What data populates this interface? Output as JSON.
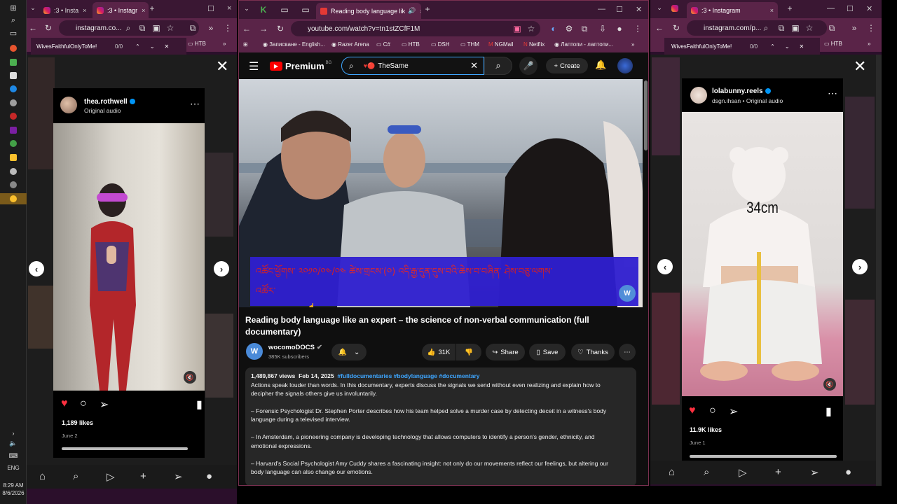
{
  "taskbar": {
    "time": "8:29 AM",
    "date": "8/6/2026",
    "language": "ENG"
  },
  "left_window": {
    "tabs": [
      {
        "label": ":3 • Insta"
      },
      {
        "label": ":3 • Instagr"
      }
    ],
    "address": "instagram.co...",
    "find_text": "WivesFaithfulOnlyToMe!",
    "find_count": "0/0",
    "bookmark": "HTB",
    "post": {
      "username": "thea.rothwell",
      "audio": "Original audio",
      "likes": "1,189 likes",
      "date": "June 2"
    }
  },
  "center_window": {
    "tab_title": "Reading body language lik",
    "address": "youtube.com/watch?v=tn1stZCfF1M",
    "bookmarks": [
      "Записване - English...",
      "Razer Arena",
      "C#",
      "HTB",
      "DSH",
      "THM",
      "NGMail",
      "Netflix",
      "Лаптопи - лаптопи..."
    ],
    "youtube": {
      "logo": "Premium",
      "logo_region": "BG",
      "search_query": "TheSame",
      "search_emoji": "♥🔴",
      "create_label": "Create",
      "video_title": "Reading body language like an expert – the science of non-verbal communication (full documentary)",
      "channel": "wocomoDOCS",
      "subscribers": "385K subscribers",
      "like_count": "31K",
      "share_label": "Share",
      "save_label": "Save",
      "thanks_label": "Thanks",
      "views": "1,489,867 views",
      "upload_date": "Feb 14, 2025",
      "hashtags": "#fulldocumentaries #bodylanguage #documentary",
      "description": [
        "Actions speak louder than words. In this documentary, experts discuss the signals we send without even realizing and explain how to",
        "decipher the signals others give us involuntarily.",
        "– Forensic Psychologist Dr. Stephen Porter describes how his team helped solve a murder case by detecting deceit in a witness's body",
        "language during a televised interview.",
        "– In Amsterdam, a pioneering company is developing technology that allows computers to identify a person's gender, ethnicity, and",
        "emotional expressions.",
        "– Harvard's Social Psychologist Amy Cuddy shares a fascinating insight: not only do our movements reflect our feelings, but altering our",
        "body language can also change our emotions."
      ],
      "subtitle_text": "འཚོང་ཕྱོགས་ ༢༠༡༠/༠༤/༠༤ ཚེས་གྲངས་(༠) འདི་རྒྱ་དུན་དུས་བའི་ཆེས་བ་བཞིན་ ཤེས་བཅུ་ལགས་",
      "subtitle_text_2": "འཚོར་"
    }
  },
  "right_window": {
    "tabs": [
      {
        "label": ":3 • Instagram"
      }
    ],
    "address": "instagram.com/p...",
    "find_text": "WivesFaithfulOnlyToMe!",
    "find_count": "0/0",
    "bookmark": "HTB",
    "post": {
      "username": "lolabunny.reels",
      "audio": "dsgn.ihsan • Original audio",
      "overlay_text": "34cm",
      "likes": "11.9K likes",
      "date": "June 1"
    }
  },
  "colors": {
    "browser_frame": "#5a2448",
    "youtube_bg": "#0f0f0f",
    "instagram_like": "#ff3040",
    "subtitle_band": "#2f1fd0"
  }
}
